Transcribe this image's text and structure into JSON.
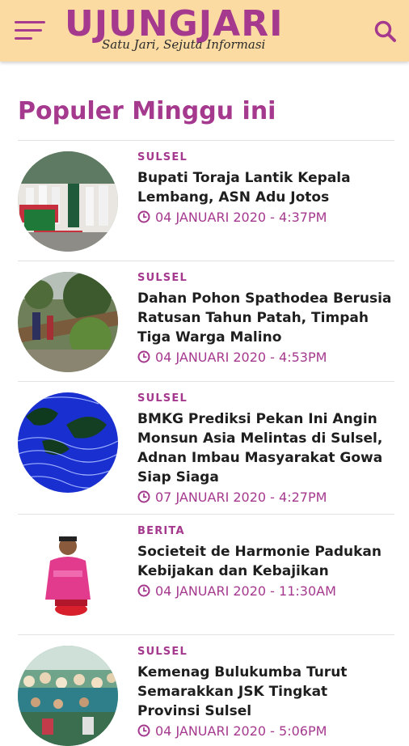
{
  "header": {
    "logo_text": "UJUNGJARI",
    "tagline": "Satu Jari, Sejuta Informasi",
    "menu_icon": "hamburger-menu-icon",
    "search_icon": "search-icon",
    "background": "#fcdba3",
    "accent": "#a5398e"
  },
  "section": {
    "title": "Populer Minggu ini"
  },
  "articles": [
    {
      "category": "SULSEL",
      "title": "Bupati Toraja Lantik Kepala Lembang, ASN Adu Jotos",
      "date": "04 JANUARI 2020 - 4:37PM"
    },
    {
      "category": "SULSEL",
      "title": "Dahan Pohon Spathodea Berusia Ratusan Tahun Patah, Timpah Tiga Warga Malino",
      "date": "04 JANUARI 2020 - 4:53PM"
    },
    {
      "category": "SULSEL",
      "title": "BMKG Prediksi Pekan Ini Angin Monsun Asia Melintas di Sulsel, Adnan Imbau Masyarakat Gowa Siap Siaga",
      "date": "07 JANUARI 2020 - 4:27PM"
    },
    {
      "category": "BERITA",
      "title": "Societeit de Harmonie Padukan Kebijakan dan Kebajikan",
      "date": "04 JANUARI 2020 - 11:30AM"
    },
    {
      "category": "SULSEL",
      "title": "Kemenag Bulukumba Turut Semarakkan JSK Tingkat Provinsi Sulsel",
      "date": "04 JANUARI 2020 - 5:06PM"
    }
  ]
}
